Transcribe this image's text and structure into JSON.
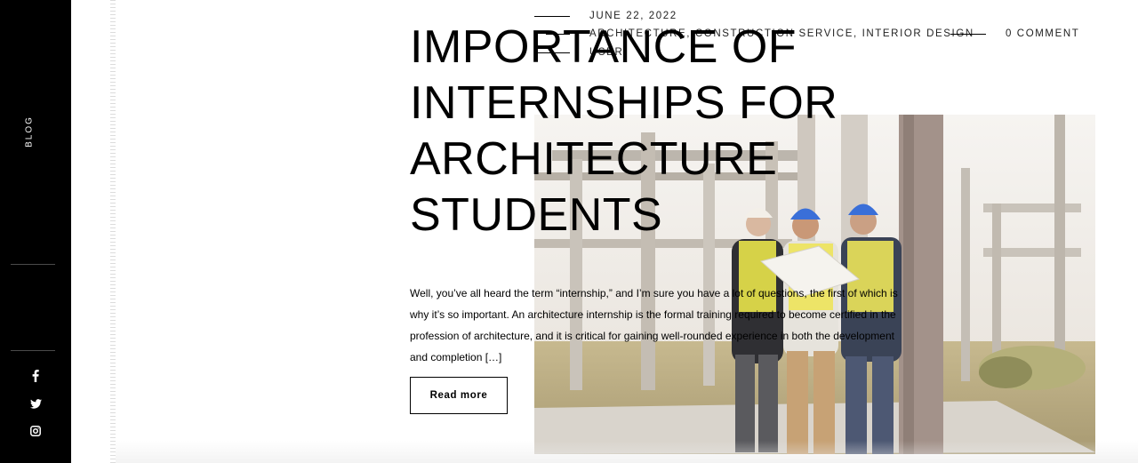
{
  "sidebar": {
    "label": "BLOG",
    "social": [
      {
        "icon": "facebook-icon"
      },
      {
        "icon": "twitter-icon"
      },
      {
        "icon": "instagram-icon"
      }
    ]
  },
  "post": {
    "date": "JUNE 22, 2022",
    "categories": "ARCHITECTURE, CONSTRUCTION SERVICE, INTERIOR DESIGN",
    "author": "USER",
    "comments": "0 COMMENT",
    "title": "IMPORTANCE OF INTERNSHIPS FOR ARCHITECTURE STUDENTS",
    "excerpt": "Well, you’ve all heard the term “internship,” and I’m sure you have a lot of questions, the first of which is why it’s so important. An architecture internship is the formal training required to become certified in the profession of architecture, and it is critical for gaining well-rounded experience in both the development and completion […]",
    "read_more_label": "Read more",
    "image_alt": "Three architects in hard hats reviewing plans at a construction site"
  }
}
